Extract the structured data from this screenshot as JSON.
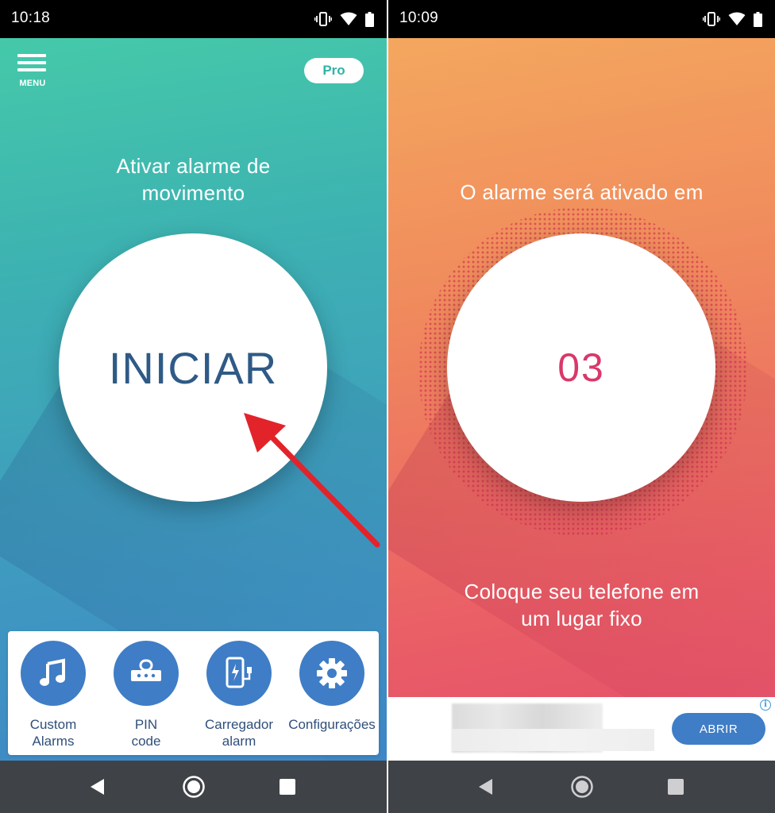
{
  "colors": {
    "left_gradient_top": "#45c9a9",
    "left_gradient_bottom": "#3f87c7",
    "right_gradient_top": "#f4a75e",
    "right_gradient_bottom": "#e24e6b",
    "accent_blue": "#3f7dc6",
    "start_text": "#2f5a86",
    "countdown_text": "#d9386a",
    "arrow_red": "#e3232a"
  },
  "left_screen": {
    "status_bar": {
      "time": "10:18",
      "icons": [
        "vibrate-icon",
        "wifi-icon",
        "battery-icon"
      ]
    },
    "menu": {
      "label": "MENU",
      "icon": "hamburger-menu-icon"
    },
    "pro_button": {
      "label": "Pro"
    },
    "headline": "Ativar alarme de movimento",
    "start_button": {
      "label": "INICIAR"
    },
    "bottom_menu": [
      {
        "label": "Custom\nAlarms",
        "icon": "music-note-icon"
      },
      {
        "label": "PIN\ncode",
        "icon": "pin-keypad-icon"
      },
      {
        "label": "Carregador\nalarm",
        "icon": "charger-icon"
      },
      {
        "label": "Configurações",
        "icon": "gear-icon"
      }
    ],
    "nav_bar": {
      "icons": [
        "back-icon",
        "home-icon",
        "recents-icon"
      ]
    }
  },
  "right_screen": {
    "status_bar": {
      "time": "10:09",
      "icons": [
        "vibrate-icon",
        "wifi-icon",
        "battery-icon"
      ]
    },
    "headline": "O alarme será ativado em",
    "countdown": "03",
    "instruction": "Coloque seu telefone em um lugar fixo",
    "ad_banner": {
      "button_label": "ABRIR",
      "info_icon": "info-icon"
    },
    "nav_bar": {
      "icons": [
        "back-icon",
        "home-icon",
        "recents-icon"
      ]
    }
  }
}
